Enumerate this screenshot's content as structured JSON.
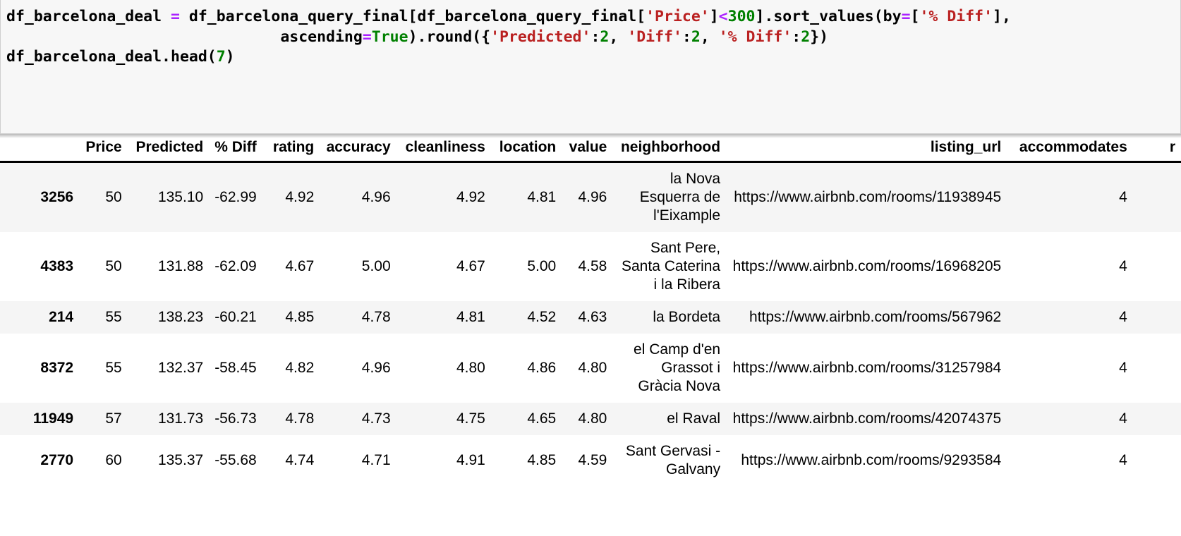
{
  "code_cell": {
    "lines": [
      [
        {
          "t": "df_barcelona_deal ",
          "c": "plain"
        },
        {
          "t": "=",
          "c": "op"
        },
        {
          "t": " df_barcelona_query_final[df_barcelona_query_final[",
          "c": "plain"
        },
        {
          "t": "'Price'",
          "c": "str"
        },
        {
          "t": "]",
          "c": "plain"
        },
        {
          "t": "<",
          "c": "op"
        },
        {
          "t": "300",
          "c": "num"
        },
        {
          "t": "].sort_values(by",
          "c": "plain"
        },
        {
          "t": "=",
          "c": "op"
        },
        {
          "t": "[",
          "c": "plain"
        },
        {
          "t": "'% Diff'",
          "c": "str"
        },
        {
          "t": "],",
          "c": "plain"
        }
      ],
      [
        {
          "t": "                              ascending",
          "c": "plain"
        },
        {
          "t": "=",
          "c": "op"
        },
        {
          "t": "True",
          "c": "kw"
        },
        {
          "t": ").round({",
          "c": "plain"
        },
        {
          "t": "'Predicted'",
          "c": "str"
        },
        {
          "t": ":",
          "c": "plain"
        },
        {
          "t": "2",
          "c": "num"
        },
        {
          "t": ", ",
          "c": "plain"
        },
        {
          "t": "'Diff'",
          "c": "str"
        },
        {
          "t": ":",
          "c": "plain"
        },
        {
          "t": "2",
          "c": "num"
        },
        {
          "t": ", ",
          "c": "plain"
        },
        {
          "t": "'% Diff'",
          "c": "str"
        },
        {
          "t": ":",
          "c": "plain"
        },
        {
          "t": "2",
          "c": "num"
        },
        {
          "t": "})",
          "c": "plain"
        }
      ],
      [
        {
          "t": "df_barcelona_deal.head(",
          "c": "plain"
        },
        {
          "t": "7",
          "c": "num"
        },
        {
          "t": ")",
          "c": "plain"
        }
      ]
    ]
  },
  "dataframe": {
    "columns": [
      "",
      "Price",
      "Predicted",
      "% Diff",
      "rating",
      "accuracy",
      "cleanliness",
      "location",
      "value",
      "neighborhood",
      "listing_url",
      "accommodates",
      "r"
    ],
    "rows": [
      {
        "index": "3256",
        "price": "50",
        "predicted": "135.10",
        "pct_diff": "-62.99",
        "rating": "4.92",
        "accuracy": "4.96",
        "cleanliness": "4.92",
        "location": "4.81",
        "value": "4.96",
        "neighborhood": "la Nova Esquerra de l'Eixample",
        "listing_url": "https://www.airbnb.com/rooms/11938945",
        "accommodates": "4",
        "last": ""
      },
      {
        "index": "4383",
        "price": "50",
        "predicted": "131.88",
        "pct_diff": "-62.09",
        "rating": "4.67",
        "accuracy": "5.00",
        "cleanliness": "4.67",
        "location": "5.00",
        "value": "4.58",
        "neighborhood": "Sant Pere, Santa Caterina i la Ribera",
        "listing_url": "https://www.airbnb.com/rooms/16968205",
        "accommodates": "4",
        "last": ""
      },
      {
        "index": "214",
        "price": "55",
        "predicted": "138.23",
        "pct_diff": "-60.21",
        "rating": "4.85",
        "accuracy": "4.78",
        "cleanliness": "4.81",
        "location": "4.52",
        "value": "4.63",
        "neighborhood": "la Bordeta",
        "listing_url": "https://www.airbnb.com/rooms/567962",
        "accommodates": "4",
        "last": ""
      },
      {
        "index": "8372",
        "price": "55",
        "predicted": "132.37",
        "pct_diff": "-58.45",
        "rating": "4.82",
        "accuracy": "4.96",
        "cleanliness": "4.80",
        "location": "4.86",
        "value": "4.80",
        "neighborhood": "el Camp d'en Grassot i Gràcia Nova",
        "listing_url": "https://www.airbnb.com/rooms/31257984",
        "accommodates": "4",
        "last": ""
      },
      {
        "index": "11949",
        "price": "57",
        "predicted": "131.73",
        "pct_diff": "-56.73",
        "rating": "4.78",
        "accuracy": "4.73",
        "cleanliness": "4.75",
        "location": "4.65",
        "value": "4.80",
        "neighborhood": "el Raval",
        "listing_url": "https://www.airbnb.com/rooms/42074375",
        "accommodates": "4",
        "last": ""
      },
      {
        "index": "2770",
        "price": "60",
        "predicted": "135.37",
        "pct_diff": "-55.68",
        "rating": "4.74",
        "accuracy": "4.71",
        "cleanliness": "4.91",
        "location": "4.85",
        "value": "4.59",
        "neighborhood": "Sant Gervasi - Galvany",
        "listing_url": "https://www.airbnb.com/rooms/9293584",
        "accommodates": "4",
        "last": ""
      }
    ]
  },
  "colors": {
    "cell_background": "#f7f7f7",
    "cell_border": "#cfcfcf",
    "string_token": "#ba2121",
    "number_token": "#008000",
    "keyword_token": "#008000",
    "operator_token": "#aa22ff",
    "row_stripe": "#f5f5f5",
    "text": "#000000"
  }
}
